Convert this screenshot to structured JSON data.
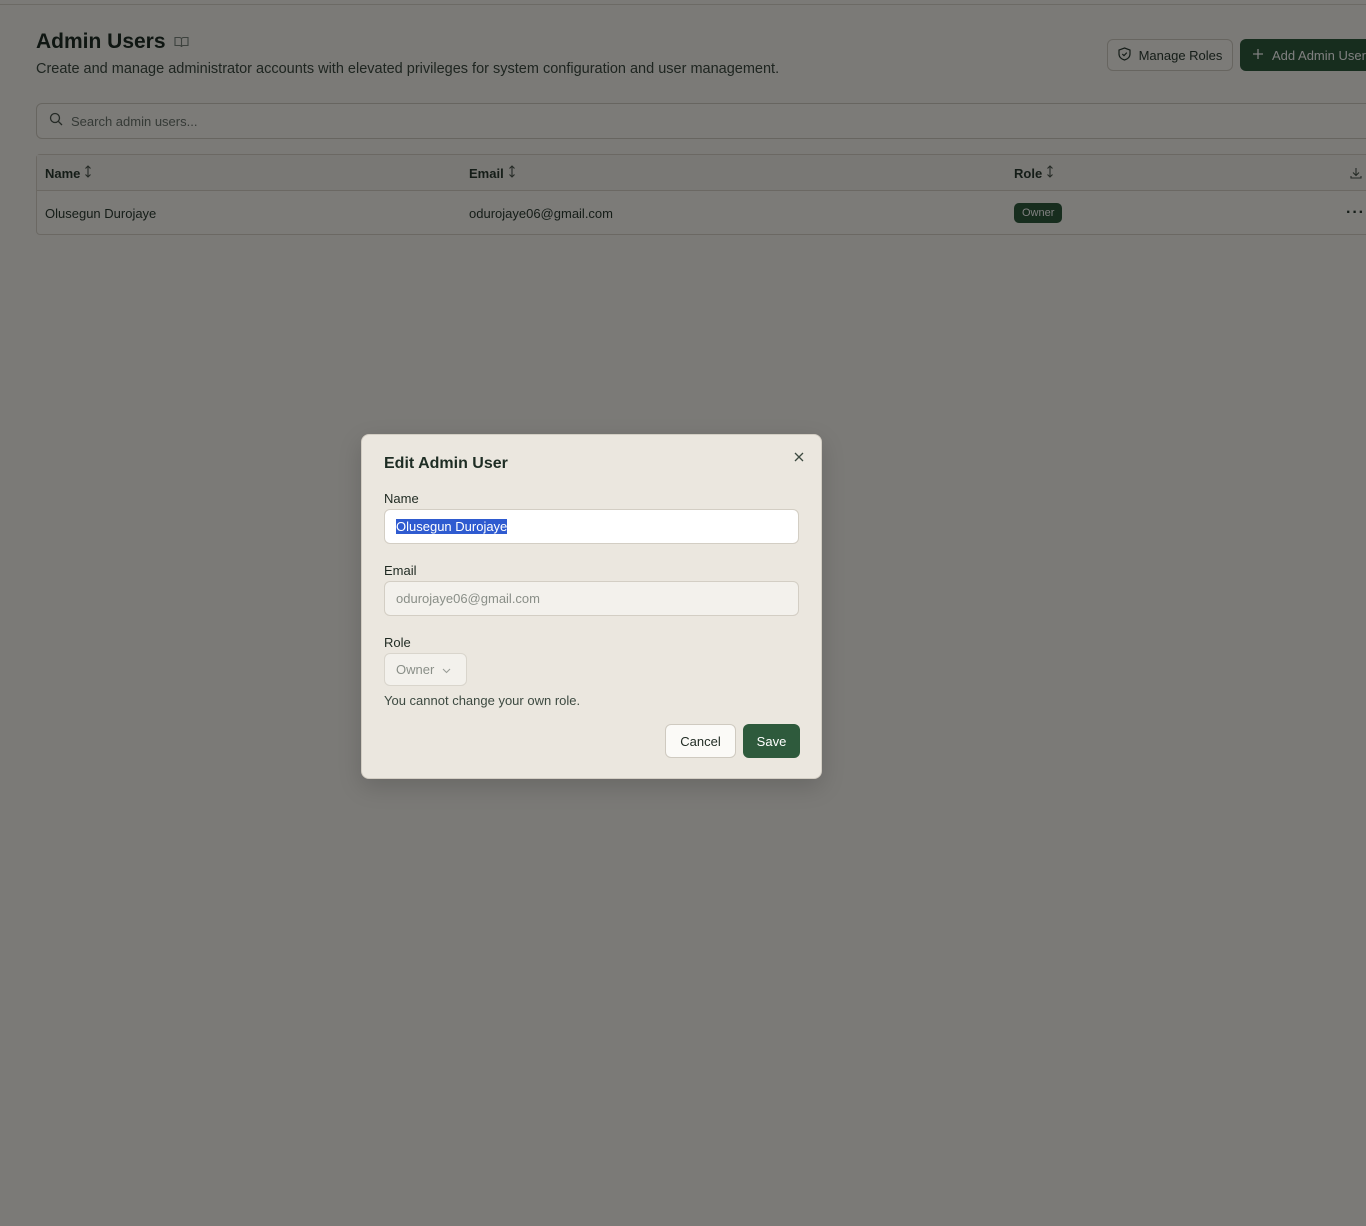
{
  "page": {
    "title": "Admin Users",
    "subtitle": "Create and manage administrator accounts with elevated privileges for system configuration and user management.",
    "manage_roles_label": "Manage Roles",
    "add_admin_label": "Add Admin User"
  },
  "search": {
    "placeholder": "Search admin users..."
  },
  "table": {
    "columns": [
      "Name",
      "Email",
      "Role"
    ],
    "rows": [
      {
        "name": "Olusegun Durojaye",
        "email": "odurojaye06@gmail.com",
        "role": "Owner"
      }
    ]
  },
  "dialog": {
    "title": "Edit Admin User",
    "name_label": "Name",
    "name_value": "Olusegun Durojaye",
    "email_label": "Email",
    "email_value": "odurojaye06@gmail.com",
    "role_label": "Role",
    "role_value": "Owner",
    "hint": "You cannot change your own role.",
    "cancel_label": "Cancel",
    "save_label": "Save"
  },
  "colors": {
    "primary": "#2e5a3c",
    "selection": "#2f5bd0",
    "overlay": "rgba(0,0,0,0.5)"
  },
  "icons": [
    "book-icon",
    "shield-icon",
    "plus-icon",
    "search-icon",
    "sort-icon",
    "download-icon",
    "more-icon",
    "close-icon",
    "chevron-down-icon"
  ]
}
